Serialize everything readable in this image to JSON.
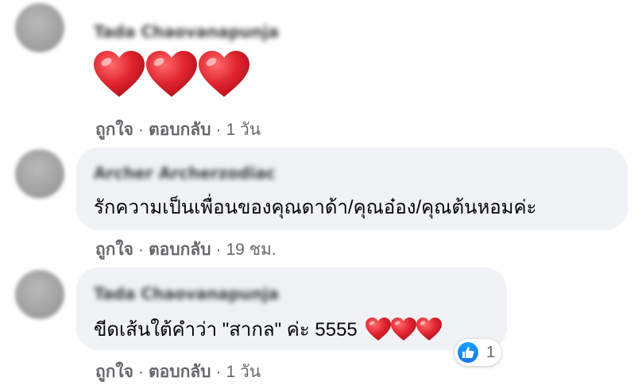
{
  "comments": [
    {
      "author": "Tada Chaovanapunja",
      "content": "",
      "emoji": [
        "heart",
        "heart",
        "heart"
      ],
      "actions": {
        "like": "ถูกใจ",
        "reply": "ตอบกลับ",
        "time": "1 วัน"
      }
    },
    {
      "author": "Archer Archerzodiac",
      "content": "รักความเป็นเพื่อนของคุณดาด้า/คุณอ๋อง/คุณต้นหอมค่ะ",
      "actions": {
        "like": "ถูกใจ",
        "reply": "ตอบกลับ",
        "time": "19 ชม."
      }
    },
    {
      "author": "Tada Chaovanapunja",
      "content": "ขีดเส้นใต้คำว่า \"สากล\" ค่ะ 5555",
      "emoji": [
        "heart",
        "heart",
        "heart"
      ],
      "reaction": {
        "icon": "like-icon",
        "count": "1"
      },
      "actions": {
        "like": "ถูกใจ",
        "reply": "ตอบกลับ",
        "time": "1 วัน"
      }
    }
  ],
  "separator": "·",
  "colors": {
    "bubble": "#f0f2f5",
    "meta": "#65676b",
    "like_blue": "#1877f2",
    "heart_red": "#e0242e"
  }
}
